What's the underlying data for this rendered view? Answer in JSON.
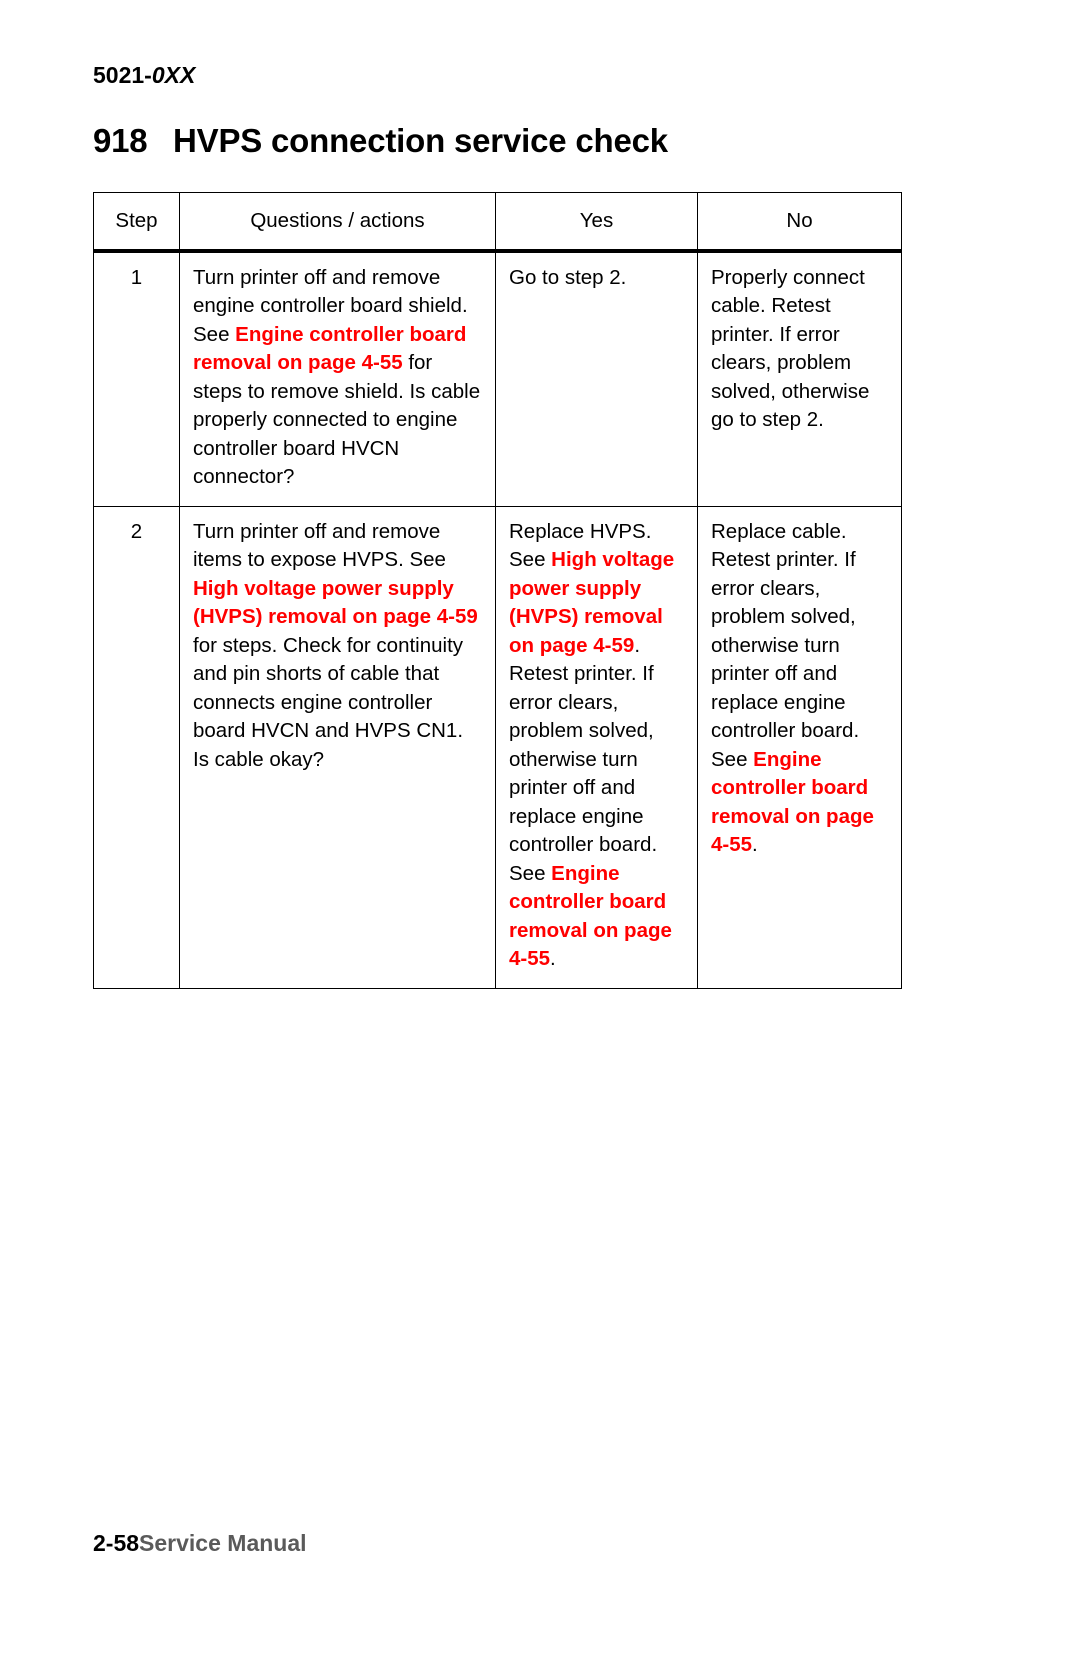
{
  "header": {
    "model": "5021-",
    "suffix": "0XX"
  },
  "title": {
    "number": "918",
    "text": "HVPS connection service check"
  },
  "colors": {
    "link": "#ff0000",
    "text": "#000000",
    "footer_manual": "#5a5a5a"
  },
  "table": {
    "columns": [
      "Step",
      "Questions / actions",
      "Yes",
      "No"
    ],
    "rows": [
      {
        "step": "1",
        "questions": [
          {
            "t": "Turn printer off and remove engine controller board shield. See ",
            "k": "plain"
          },
          {
            "t": "Engine controller board removal on page 4-55",
            "k": "link"
          },
          {
            "t": " for steps to remove shield. Is cable properly connected to engine controller board HVCN connector?",
            "k": "plain"
          }
        ],
        "yes": [
          {
            "t": "Go to step 2.",
            "k": "plain"
          }
        ],
        "no": [
          {
            "t": "Properly connect cable. Retest printer. If error clears, problem solved, otherwise go to step 2.",
            "k": "plain"
          }
        ]
      },
      {
        "step": "2",
        "questions": [
          {
            "t": "Turn printer off and remove items to expose HVPS. See ",
            "k": "plain"
          },
          {
            "t": "High voltage power supply (HVPS) removal on page 4-59",
            "k": "link"
          },
          {
            "t": " for steps. Check for continuity and pin shorts of cable that connects engine controller board HVCN and HVPS CN1. Is cable okay?",
            "k": "plain"
          }
        ],
        "yes": [
          {
            "t": "Replace HVPS. See ",
            "k": "plain"
          },
          {
            "t": "High voltage power supply (HVPS) removal on page 4-59",
            "k": "link"
          },
          {
            "t": ". Retest printer. If error clears, problem solved, otherwise turn printer off and replace engine controller board. See ",
            "k": "plain"
          },
          {
            "t": "Engine controller board removal on page 4-55",
            "k": "link"
          },
          {
            "t": ".",
            "k": "plain"
          }
        ],
        "no": [
          {
            "t": "Replace cable. Retest printer. If error clears, problem solved, otherwise turn printer off and replace engine controller board. See ",
            "k": "plain"
          },
          {
            "t": "Engine controller board removal on page 4-55",
            "k": "link"
          },
          {
            "t": ".",
            "k": "plain"
          }
        ]
      }
    ]
  },
  "footer": {
    "page_number": "2-58",
    "manual_label": "Service Manual"
  }
}
